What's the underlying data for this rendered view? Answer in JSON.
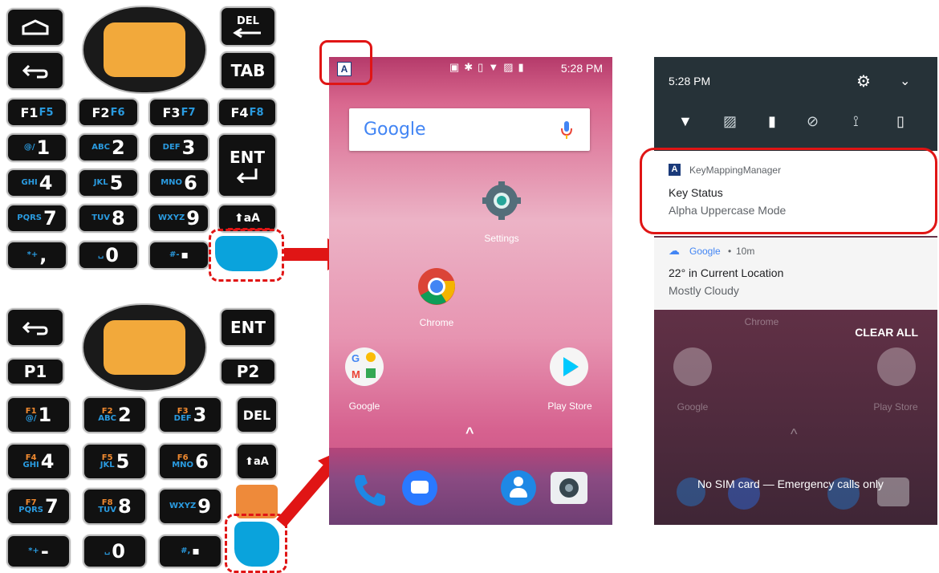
{
  "keypad_top": {
    "del_label": "DEL",
    "tab_label": "TAB",
    "fkeys": [
      {
        "main": "F1",
        "alt": "F5"
      },
      {
        "main": "F2",
        "alt": "F6"
      },
      {
        "main": "F3",
        "alt": "F7"
      },
      {
        "main": "F4",
        "alt": "F8"
      }
    ],
    "ent_label": "ENT",
    "digits": [
      {
        "sub": "@/",
        "digit": "1"
      },
      {
        "sub": "ABC",
        "digit": "2"
      },
      {
        "sub": "DEF",
        "digit": "3"
      },
      {
        "sub": "GHI",
        "digit": "4"
      },
      {
        "sub": "JKL",
        "digit": "5"
      },
      {
        "sub": "MNO",
        "digit": "6"
      },
      {
        "sub": "PQRS",
        "digit": "7"
      },
      {
        "sub": "TUV",
        "digit": "8"
      },
      {
        "sub": "WXYZ",
        "digit": "9"
      },
      {
        "sub": "*+",
        "digit": ","
      },
      {
        "sub": "␣",
        "digit": "0"
      },
      {
        "sub": "#-",
        "digit": "▪"
      }
    ],
    "shift_label": "aA"
  },
  "keypad_bottom": {
    "ent_label": "ENT",
    "p1_label": "P1",
    "p2_label": "P2",
    "del_label": "DEL",
    "shift_label": "aA",
    "digits": [
      {
        "f": "F1",
        "sub": "@/",
        "digit": "1"
      },
      {
        "f": "F2",
        "sub": "ABC",
        "digit": "2"
      },
      {
        "f": "F3",
        "sub": "DEF",
        "digit": "3"
      },
      {
        "f": "F4",
        "sub": "GHI",
        "digit": "4"
      },
      {
        "f": "F5",
        "sub": "JKL",
        "digit": "5"
      },
      {
        "f": "F6",
        "sub": "MNO",
        "digit": "6"
      },
      {
        "f": "F7",
        "sub": "PQRS",
        "digit": "7"
      },
      {
        "f": "F8",
        "sub": "TUV",
        "digit": "8"
      },
      {
        "f": "",
        "sub": "WXYZ",
        "digit": "9"
      },
      {
        "f": "",
        "sub": "*+",
        "digit": "-"
      },
      {
        "f": "",
        "sub": "␣",
        "digit": "0"
      },
      {
        "f": "",
        "sub": "#,",
        "digit": "▪"
      }
    ]
  },
  "home": {
    "status_indicator": "A",
    "time": "5:28 PM",
    "search_logo": "Google",
    "apps": {
      "settings": "Settings",
      "chrome": "Chrome",
      "google": "Google",
      "play_store": "Play Store"
    },
    "drawer_arrow": "^"
  },
  "shade": {
    "time": "5:28 PM",
    "notifications": [
      {
        "app": "KeyMappingManager",
        "title": "Key Status",
        "text": "Alpha Uppercase Mode"
      },
      {
        "app": "Google",
        "age": "10m",
        "title": "22° in Current Location",
        "text": "Mostly Cloudy"
      }
    ],
    "clear_all": "CLEAR ALL",
    "bg_apps": {
      "chrome": "Chrome",
      "google": "Google",
      "play_store": "Play Store"
    },
    "sim_text": "No SIM card — Emergency calls only"
  },
  "colors": {
    "highlight": "#e01515",
    "blue_key": "#0aa3dc",
    "orange_key": "#f2a93b"
  }
}
